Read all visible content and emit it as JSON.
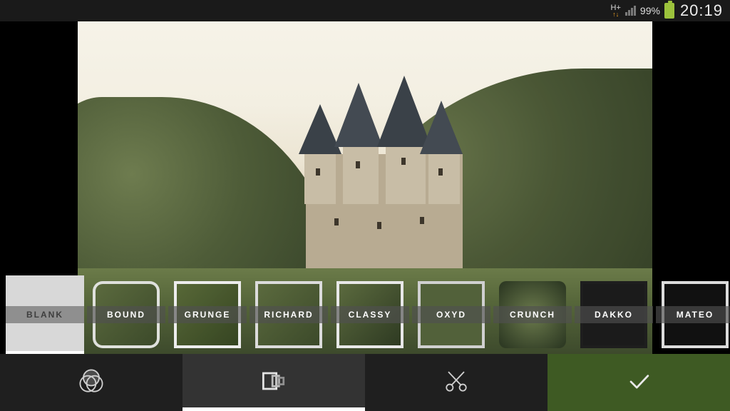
{
  "status": {
    "network_type": "H+",
    "battery_pct": "99%",
    "clock": "20:19"
  },
  "filters": {
    "selected_index": 0,
    "items": [
      {
        "id": "blank",
        "label": "BLANK"
      },
      {
        "id": "bound",
        "label": "BOUND"
      },
      {
        "id": "grunge",
        "label": "GRUNGE"
      },
      {
        "id": "richard",
        "label": "RICHARD"
      },
      {
        "id": "classy",
        "label": "CLASSY"
      },
      {
        "id": "oxyd",
        "label": "OXYD"
      },
      {
        "id": "crunch",
        "label": "CRUNCH"
      },
      {
        "id": "dakko",
        "label": "DAKKO"
      },
      {
        "id": "mateo",
        "label": "MATEO"
      }
    ]
  },
  "toolbar": {
    "tabs": [
      {
        "id": "effects",
        "icon": "venn-icon",
        "active": false
      },
      {
        "id": "frames",
        "icon": "frames-icon",
        "active": true
      },
      {
        "id": "crop",
        "icon": "scissors-icon",
        "active": false
      },
      {
        "id": "confirm",
        "icon": "check-icon",
        "active": false
      }
    ],
    "active_index": 1
  },
  "colors": {
    "confirm_bg": "#3e5a23",
    "battery": "#9cc23c"
  },
  "icons": {
    "venn-icon": "effects",
    "frames-icon": "frames",
    "scissors-icon": "crop",
    "check-icon": "confirm"
  }
}
